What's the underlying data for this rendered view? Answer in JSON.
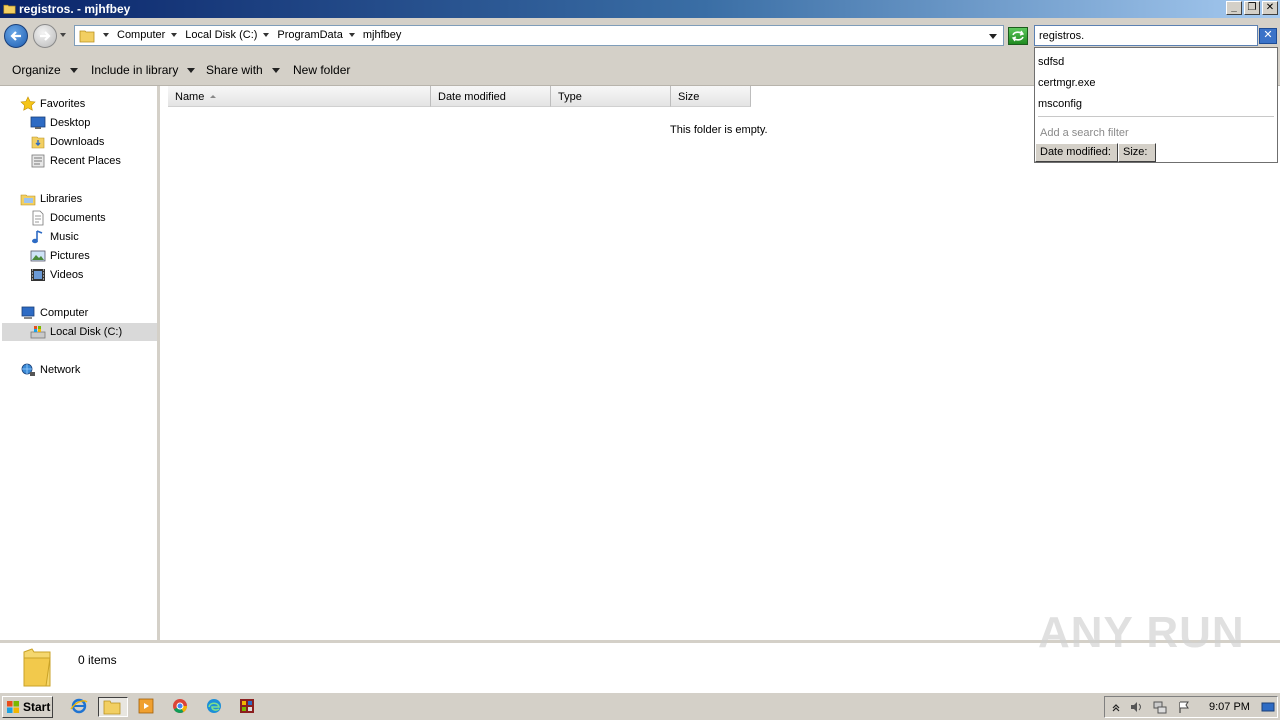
{
  "window": {
    "title": "registros. - mjhfbey"
  },
  "address": {
    "crumbs": [
      "Computer",
      "Local Disk (C:)",
      "ProgramData",
      "mjhfbey"
    ]
  },
  "search": {
    "value": "registros.",
    "suggestions": [
      "sdfsd",
      "certmgr.exe",
      "msconfig"
    ],
    "hint": "Add a search filter",
    "filters": [
      "Date modified:",
      "Size:"
    ]
  },
  "toolbar": {
    "organize": "Organize",
    "include_in_library": "Include in library",
    "share_with": "Share with",
    "new_folder": "New folder"
  },
  "nav": {
    "favorites": "Favorites",
    "desktop": "Desktop",
    "downloads": "Downloads",
    "recent_places": "Recent Places",
    "libraries": "Libraries",
    "documents": "Documents",
    "music": "Music",
    "pictures": "Pictures",
    "videos": "Videos",
    "computer": "Computer",
    "local_disk": "Local Disk (C:)",
    "network": "Network"
  },
  "columns": {
    "name": "Name",
    "date_modified": "Date modified",
    "type": "Type",
    "size": "Size"
  },
  "content": {
    "empty_message": "This folder is empty."
  },
  "details": {
    "item_count": "0 items"
  },
  "watermark": "ANY RUN",
  "taskbar": {
    "start": "Start",
    "clock": "9:07 PM"
  },
  "colors": {
    "title_bar": "#0a246a",
    "chrome": "#d4d0c8",
    "selection": "#d9d9d9"
  }
}
